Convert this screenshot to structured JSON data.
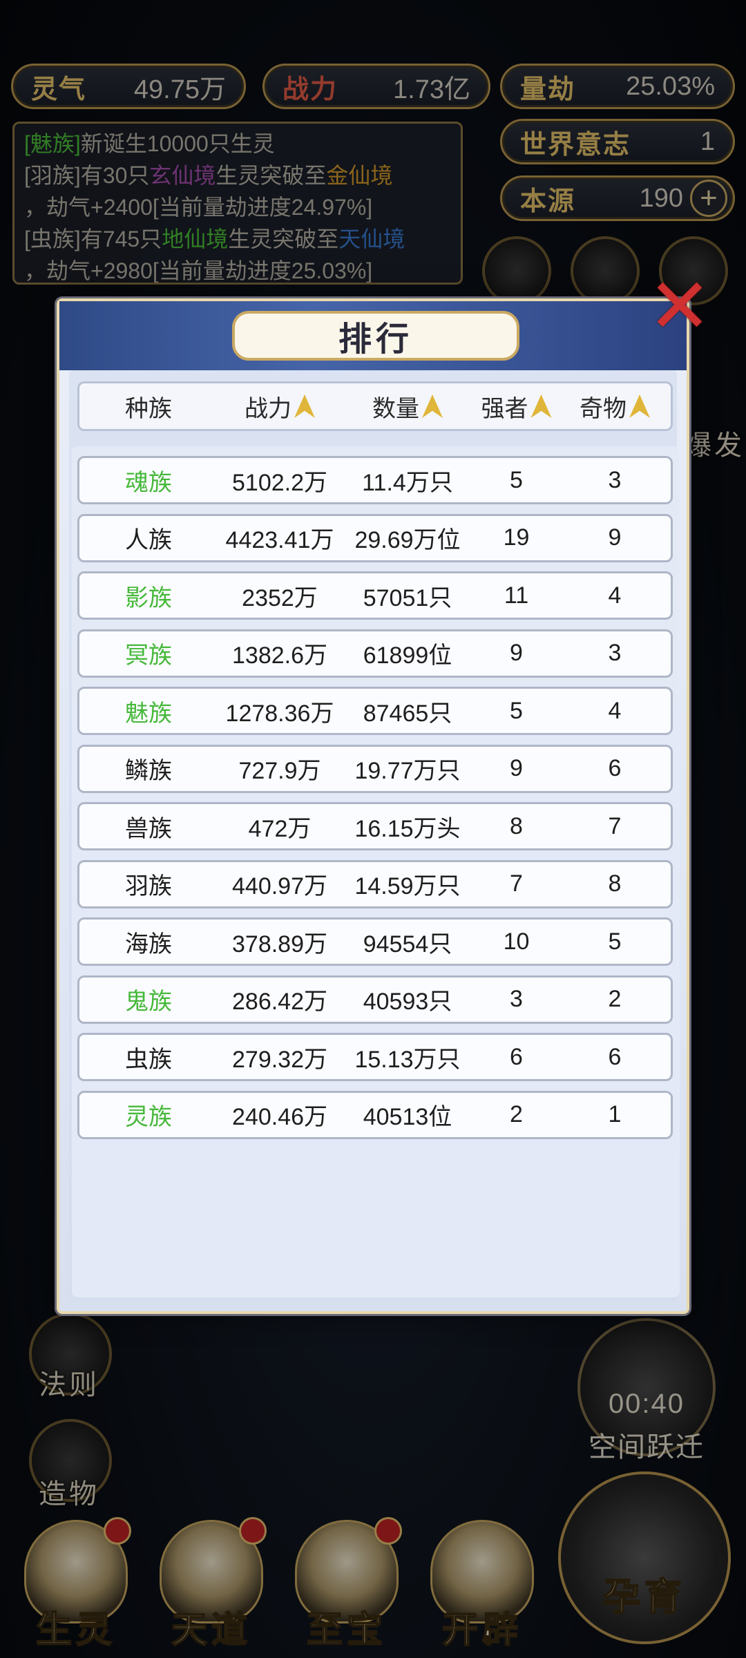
{
  "top_stats": {
    "lingqi": {
      "label": "灵气",
      "value": "49.75万"
    },
    "zhanli": {
      "label": "战力",
      "value": "1.73亿"
    },
    "liangjie": {
      "label": "量劫",
      "value": "25.03%"
    },
    "shijie": {
      "label": "世界意志",
      "value": "1"
    },
    "benyuan": {
      "label": "本源",
      "value": "190"
    }
  },
  "log": {
    "line1": {
      "race": "[魅族]",
      "text": "新诞生10000只生灵"
    },
    "line2": {
      "a": "[羽族]有30只",
      "b": "玄仙境",
      "c": "生灵突破至",
      "d": "金仙境"
    },
    "line3": "，劫气+2400[当前量劫进度24.97%]",
    "line4": {
      "a": "[虫族]有745只",
      "b": "地仙境",
      "c": "生灵突破至",
      "d": "天仙境"
    },
    "line5": "，劫气+2980[当前量劫进度25.03%]"
  },
  "side": {
    "fa_ze": "法则",
    "zao_wu": "造物",
    "bao_fa": "爆发",
    "space_jump": {
      "timer": "00:40",
      "label": "空间跃迁"
    }
  },
  "bottom_nav": [
    "生灵",
    "天道",
    "至宝",
    "开辟"
  ],
  "incubate": "孕育",
  "ranking": {
    "title": "排行",
    "headers": {
      "race": "种族",
      "power": "战力",
      "count": "数量",
      "strong": "强者",
      "treasure": "奇物"
    },
    "rows": [
      {
        "race": "魂族",
        "power": "5102.2万",
        "count": "11.4万只",
        "strong": "5",
        "treasure": "3",
        "highlight": true
      },
      {
        "race": "人族",
        "power": "4423.41万",
        "count": "29.69万位",
        "strong": "19",
        "treasure": "9",
        "highlight": false
      },
      {
        "race": "影族",
        "power": "2352万",
        "count": "57051只",
        "strong": "11",
        "treasure": "4",
        "highlight": true
      },
      {
        "race": "冥族",
        "power": "1382.6万",
        "count": "61899位",
        "strong": "9",
        "treasure": "3",
        "highlight": true
      },
      {
        "race": "魅族",
        "power": "1278.36万",
        "count": "87465只",
        "strong": "5",
        "treasure": "4",
        "highlight": true
      },
      {
        "race": "鳞族",
        "power": "727.9万",
        "count": "19.77万只",
        "strong": "9",
        "treasure": "6",
        "highlight": false
      },
      {
        "race": "兽族",
        "power": "472万",
        "count": "16.15万头",
        "strong": "8",
        "treasure": "7",
        "highlight": false
      },
      {
        "race": "羽族",
        "power": "440.97万",
        "count": "14.59万只",
        "strong": "7",
        "treasure": "8",
        "highlight": false
      },
      {
        "race": "海族",
        "power": "378.89万",
        "count": "94554只",
        "strong": "10",
        "treasure": "5",
        "highlight": false
      },
      {
        "race": "鬼族",
        "power": "286.42万",
        "count": "40593只",
        "strong": "3",
        "treasure": "2",
        "highlight": true
      },
      {
        "race": "虫族",
        "power": "279.32万",
        "count": "15.13万只",
        "strong": "6",
        "treasure": "6",
        "highlight": false
      },
      {
        "race": "灵族",
        "power": "240.46万",
        "count": "40513位",
        "strong": "2",
        "treasure": "1",
        "highlight": true
      }
    ]
  },
  "colors": {
    "highlight": "#46b83a",
    "gold": "#c9a962",
    "close": "#d03030"
  }
}
